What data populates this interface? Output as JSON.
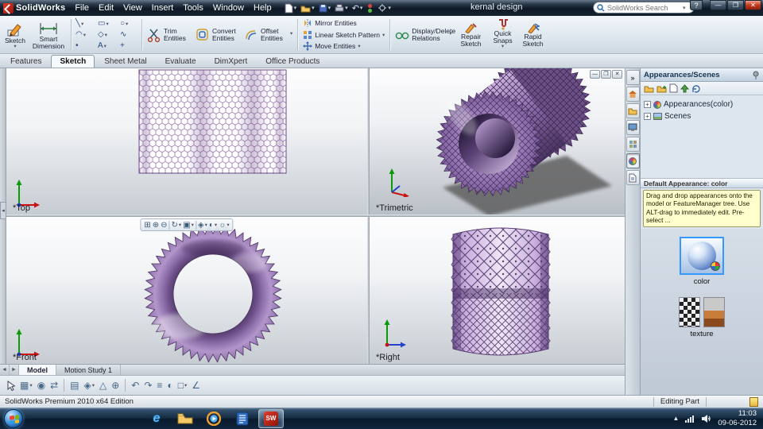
{
  "colors": {
    "model_purple": "#9a78b8",
    "selection_blue": "#3399ff",
    "tooltip_yellow": "#ffffcd",
    "taskbar_dark": "#12202f"
  },
  "titlebar": {
    "logo_text": "SolidWorks",
    "menus": [
      "File",
      "Edit",
      "View",
      "Insert",
      "Tools",
      "Window",
      "Help"
    ],
    "toolbar_icons": [
      "new-icon",
      "open-icon",
      "save-icon",
      "print-icon",
      "undo-icon",
      "rebuild-icon",
      "options-icon"
    ],
    "document_title": "kernal design",
    "search_placeholder": "SolidWorks Search"
  },
  "ribbon": {
    "sketch": "Sketch",
    "smart_dimension": "Smart Dimension",
    "trim": "Trim Entities",
    "convert": "Convert Entities",
    "offset": "Offset Entities",
    "mirror": "Mirror Entities",
    "linear_pattern": "Linear Sketch Pattern",
    "move": "Move Entities",
    "display_delete": "Display/Delete Relations",
    "repair": "Repair Sketch",
    "quick_snaps": "Quick Snaps",
    "rapid": "Rapid Sketch",
    "tool_icons": [
      "line-icon",
      "rectangle-icon",
      "circle-icon",
      "arc-icon",
      "polygon-icon",
      "spline-icon",
      "point-icon",
      "text-icon",
      "centerline-icon"
    ]
  },
  "command_tabs": {
    "items": [
      "Features",
      "Sketch",
      "Sheet Metal",
      "Evaluate",
      "DimXpert",
      "Office Products"
    ],
    "active": "Sketch"
  },
  "viewports": {
    "top": "*Top",
    "trimetric": "*Trimetric",
    "front": "*Front",
    "right": "*Right",
    "headsup_icons": [
      "zoom-fit-icon",
      "zoom-in-icon",
      "zoom-out-icon",
      "previous-view-icon",
      "rotate-view-icon",
      "standard-views-icon",
      "display-style-icon",
      "hide-show-icon",
      "appearance-icon"
    ]
  },
  "task_pane": {
    "title": "Appearances/Scenes",
    "tab_icons": [
      "collapse-icon",
      "resources-icon",
      "design-library-icon",
      "file-explorer-icon",
      "view-palette-icon",
      "appearances-icon",
      "custom-properties-icon"
    ],
    "tree": [
      "Appearances(color)",
      "Scenes"
    ],
    "default_appearance_header": "Default Appearance: color",
    "tooltip": "Drag and drop appearances onto the model or FeatureManager tree.  Use ALT-drag to immediately edit.  Pre-select ...",
    "thumb_color_label": "color",
    "thumb_texture_label": "texture"
  },
  "model_tabs": {
    "items": [
      "Model",
      "Motion Study 1"
    ],
    "active": "Model"
  },
  "bottom_toolbar_icons": [
    "select-icon",
    "grid-icon",
    "circle-icon",
    "swap-icon",
    "layers-icon",
    "diamond-icon",
    "triangle-icon",
    "add-icon",
    "undo-icon",
    "redo-icon",
    "list-icon",
    "contrast-icon",
    "box-icon",
    "angle-icon"
  ],
  "status_bar": {
    "left": "SolidWorks Premium 2010 x64 Edition",
    "mode": "Editing Part"
  },
  "taskbar": {
    "app_icons": [
      "internet-explorer-icon",
      "folder-icon",
      "media-player-icon",
      "documents-icon",
      "solidworks-icon"
    ],
    "tray_icons": [
      "hidden-icons-chevron",
      "network-icon",
      "volume-icon"
    ],
    "time": "11:03",
    "date": "09-06-2012"
  }
}
